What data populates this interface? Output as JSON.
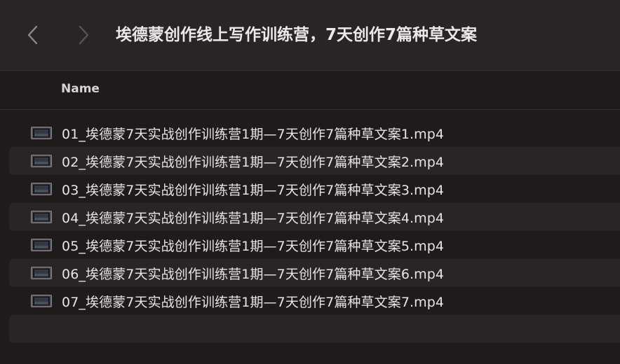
{
  "window": {
    "title": "埃德蒙创作线上写作训练营，7天创作7篇种草文案"
  },
  "toolbar": {
    "back_icon": "chevron-left-icon",
    "forward_icon": "chevron-right-icon"
  },
  "list": {
    "column_header": "Name",
    "files": [
      {
        "name": "01_埃德蒙7天实战创作训练营1期—7天创作7篇种草文案1.mp4",
        "icon": "video-file-icon"
      },
      {
        "name": "02_埃德蒙7天实战创作训练营1期—7天创作7篇种草文案2.mp4",
        "icon": "video-file-icon"
      },
      {
        "name": "03_埃德蒙7天实战创作训练营1期—7天创作7篇种草文案3.mp4",
        "icon": "video-file-icon"
      },
      {
        "name": "04_埃德蒙7天实战创作训练营1期—7天创作7篇种草文案4.mp4",
        "icon": "video-file-icon"
      },
      {
        "name": "05_埃德蒙7天实战创作训练营1期—7天创作7篇种草文案5.mp4",
        "icon": "video-file-icon"
      },
      {
        "name": "06_埃德蒙7天实战创作训练营1期—7天创作7篇种草文案6.mp4",
        "icon": "video-file-icon"
      },
      {
        "name": "07_埃德蒙7天实战创作训练营1期—7天创作7篇种草文案7.mp4",
        "icon": "video-file-icon"
      }
    ]
  },
  "colors": {
    "background": "#1f1a1b",
    "toolbar": "#2a2425",
    "alt_row": "#2a2425",
    "text": "#e8e4e5"
  }
}
